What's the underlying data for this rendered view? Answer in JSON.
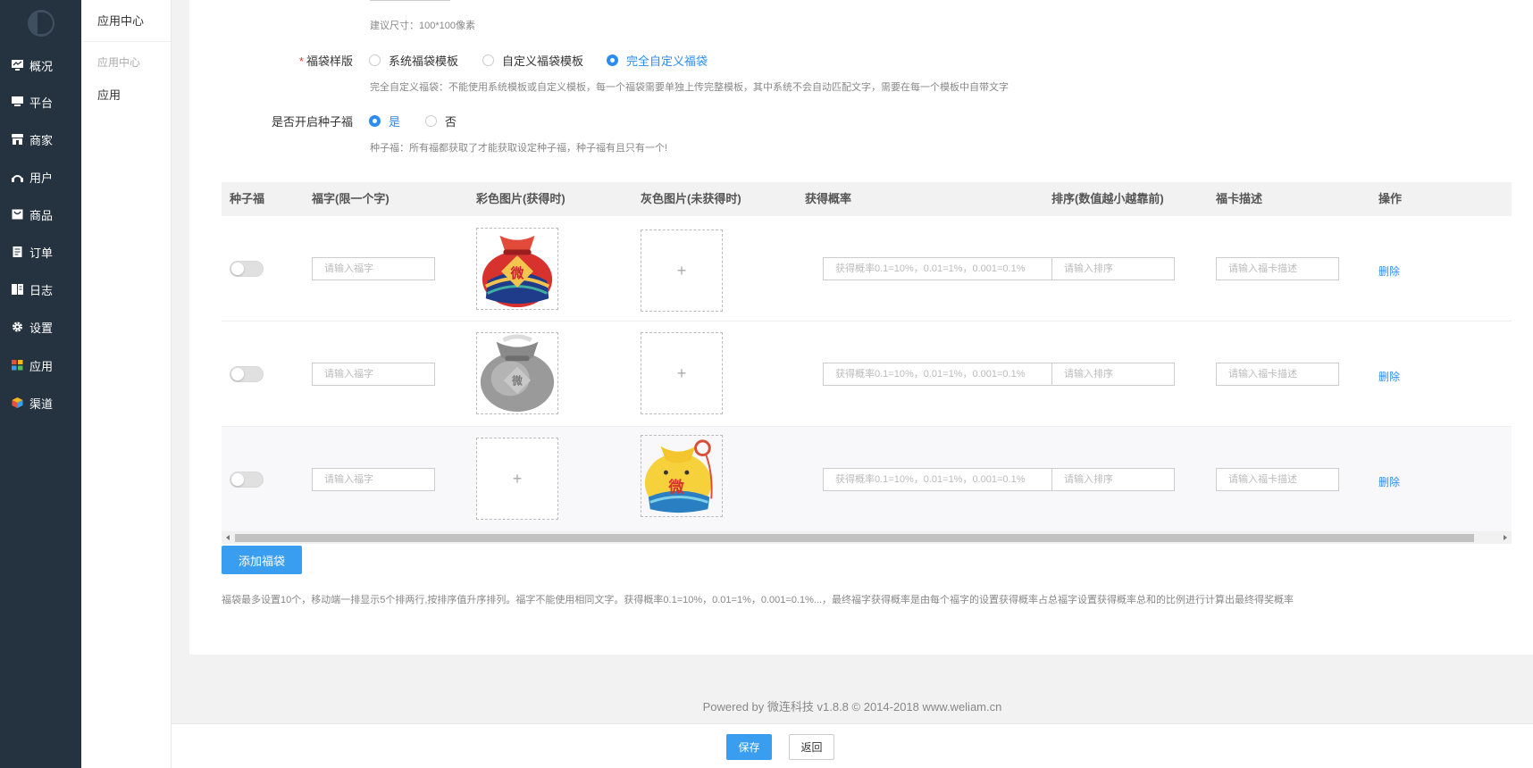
{
  "sidebar": {
    "items": [
      {
        "label": "概况",
        "icon": "dashboard-icon"
      },
      {
        "label": "平台",
        "icon": "monitor-icon"
      },
      {
        "label": "商家",
        "icon": "store-icon"
      },
      {
        "label": "用户",
        "icon": "user-icon"
      },
      {
        "label": "商品",
        "icon": "goods-icon"
      },
      {
        "label": "订单",
        "icon": "order-icon"
      },
      {
        "label": "日志",
        "icon": "log-icon"
      },
      {
        "label": "设置",
        "icon": "gear-icon"
      },
      {
        "label": "应用",
        "icon": "apps-grid-icon"
      },
      {
        "label": "渠道",
        "icon": "channel-cube-icon"
      }
    ]
  },
  "subnav": {
    "title": "应用中心",
    "group": "应用中心",
    "item": "应用"
  },
  "form": {
    "size_hint": "建议尺寸：100*100像素",
    "style_label": "福袋样版",
    "style_options": [
      "系统福袋模板",
      "自定义福袋模板",
      "完全自定义福袋"
    ],
    "style_selected": "完全自定义福袋",
    "style_hint": "完全自定义福袋：不能使用系统模板或自定义模板，每一个福袋需要单独上传完整模板，其中系统不会自动匹配文字，需要在每一个模板中自带文字",
    "seed_label": "是否开启种子福",
    "seed_options": [
      "是",
      "否"
    ],
    "seed_selected": "是",
    "seed_hint": "种子福：所有福都获取了才能获取设定种子福，种子福有且只有一个!"
  },
  "table": {
    "headers": [
      "种子福",
      "福字(限一个字)",
      "彩色图片(获得时)",
      "灰色图片(未获得时)",
      "获得概率",
      "排序(数值越小越靠前)",
      "福卡描述",
      "操作"
    ],
    "placeholders": {
      "fu_char": "请输入福字",
      "probability": "获得概率0.1=10%，0.01=1%，0.001=0.1%",
      "sort": "请输入排序",
      "desc": "请输入福卡描述"
    },
    "upload_plus": "+",
    "delete_label": "删除",
    "rows": [
      {
        "seed": false,
        "color_image": "red-lucky-bag-image",
        "gray_image": null
      },
      {
        "seed": false,
        "color_image": "gray-lucky-bag-image",
        "gray_image": null
      },
      {
        "seed": false,
        "color_image": null,
        "gray_image": "yellow-lucky-bag-image"
      }
    ],
    "bag_text": "微"
  },
  "actions": {
    "add_label": "添加福袋",
    "note": "福袋最多设置10个，移动端一排显示5个排两行,按排序值升序排列。福字不能使用相同文字。获得概率0.1=10%，0.01=1%，0.001=0.1%...，最终福字获得概率是由每个福字的设置获得概率占总福字设置获得概率总和的比例进行计算出最终得奖概率",
    "save_label": "保存",
    "back_label": "返回"
  },
  "footer": {
    "text": "Powered by 微连科技 v1.8.8 © 2014-2018 www.weliam.cn"
  },
  "colors": {
    "sidebar_bg": "#253341",
    "accent": "#2d8cf0",
    "button": "#3a9ef0",
    "required": "#e4393c"
  }
}
